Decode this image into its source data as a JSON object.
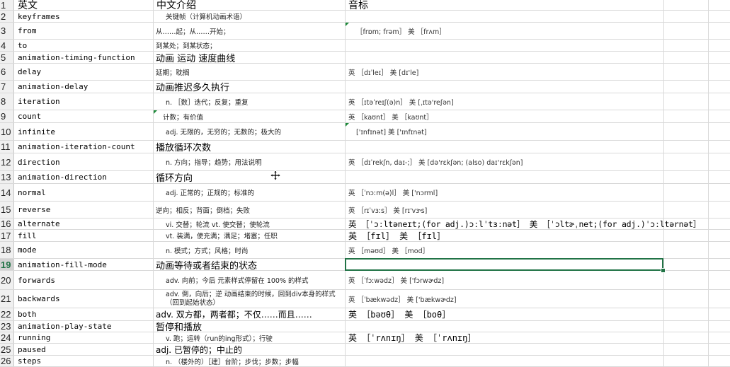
{
  "headers": {
    "col_a": "英文",
    "col_b": "中文介绍",
    "col_c": "音标"
  },
  "selected_row": "19",
  "rows": [
    {
      "n": "2",
      "en": "keyframes",
      "cn": "关键帧（计算机动画术语）",
      "ph": ""
    },
    {
      "n": "3",
      "en": "from",
      "cn": "从……起；从……开始；",
      "ph": "［frɒm; frəm］ 美 ［frʌm］"
    },
    {
      "n": "4",
      "en": "to",
      "cn": "到某处；到某状态；",
      "ph": ""
    },
    {
      "n": "5",
      "en": "animation-timing-function",
      "cn": "动画 运动 速度曲线",
      "ph": ""
    },
    {
      "n": "6",
      "en": "delay",
      "cn": "延期；耽搁",
      "ph": "英 ［dɪˈleɪ］ 美 [dɪ'le]"
    },
    {
      "n": "7",
      "en": "animation-delay",
      "cn": "动画推迟多久执行",
      "ph": ""
    },
    {
      "n": "8",
      "en": "iteration",
      "cn": "n. ［数］迭代；反复；重复",
      "ph": "英 ［ɪtəˈreɪʃ(ə)n］ 美 [ˌɪtə'reʃən]"
    },
    {
      "n": "9",
      "en": "count",
      "cn": "计数；有价值",
      "ph": "英 ［kaʊnt］ 美 ［kaʊnt］"
    },
    {
      "n": "10",
      "en": "infinite",
      "cn": "adj. 无限的，无穷的；无数的；极大的",
      "ph": "['ɪnfɪnət] 美 ['ɪnfɪnət]"
    },
    {
      "n": "11",
      "en": "animation-iteration-count",
      "cn": "播放循环次数",
      "ph": ""
    },
    {
      "n": "12",
      "en": "direction",
      "cn": "n. 方向；指导；趋势；用法说明",
      "ph": "英 ［dɪˈrekʃn, daɪ-;］ 美 [də'rɛkʃən; (also) daɪ'rɛkʃən]"
    },
    {
      "n": "13",
      "en": "animation-direction",
      "cn": "循环方向",
      "ph": ""
    },
    {
      "n": "14",
      "en": "normal",
      "cn": "adj. 正常的；正规的；标准的",
      "ph": "英 ［ˈnɔːm(ə)l］ 美 ['nɔrml]"
    },
    {
      "n": "15",
      "en": "reverse",
      "cn": "逆向；相反；背面；倒档；失败",
      "ph": "英 ［rɪˈvɜːs］ 美 [rɪ'vɝs]"
    },
    {
      "n": "16",
      "en": "alternate",
      "cn": "vi. 交替；轮流 vt. 使交替；使轮流",
      "ph": "英 ［ˈɔːltəneɪt;(for adj.)ɔːlˈtɜːnət］ 美 ［ˈɔltɚˌnet;(for adj.)ˈɔːltərnət］"
    },
    {
      "n": "17",
      "en": "fill",
      "cn": "vt. 装满，使充满；满足；堵塞；任职",
      "ph": "英 ［fɪl］ 美 ［fɪl］"
    },
    {
      "n": "18",
      "en": "mode",
      "cn": "n. 模式；方式；风格；时尚",
      "ph": "英 ［məʊd］ 美 ［mod］"
    },
    {
      "n": "19",
      "en": "animation-fill-mode",
      "cn": "动画等待或者结束的状态",
      "ph": ""
    },
    {
      "n": "20",
      "en": "forwards",
      "cn": "adv. 向前；今后 元素样式停留在 100% 的样式",
      "ph": "英 ［ˈfɔːwədz］ 美 ['fɔrwɚdz]"
    },
    {
      "n": "21",
      "en": "backwards",
      "cn": "adv. 倒，向后；逆 动画结束的时候，回到div本身的样式（回到起始状态）",
      "ph": "英 ［ˈbækwədz］ 美 ['bækwɚdz]"
    },
    {
      "n": "22",
      "en": "both",
      "cn": "adv. 双方都，两者都；不仅……而且……",
      "ph": "英 ［bəʊθ］ 美 ［boθ］"
    },
    {
      "n": "23",
      "en": "animation-play-state",
      "cn": "暂停和播放",
      "ph": ""
    },
    {
      "n": "24",
      "en": "running",
      "cn": "v. 跑；运转（run的ing形式）；行驶",
      "ph": "英 ［ˈrʌnɪŋ］ 美 ［ˈrʌnɪŋ］"
    },
    {
      "n": "25",
      "en": "paused",
      "cn": "adj. 已暂停的；中止的",
      "ph": ""
    },
    {
      "n": "26",
      "en": "steps",
      "cn": "n. （楼外的）［建］台阶；步伐；步数；步幅",
      "ph": ""
    }
  ]
}
